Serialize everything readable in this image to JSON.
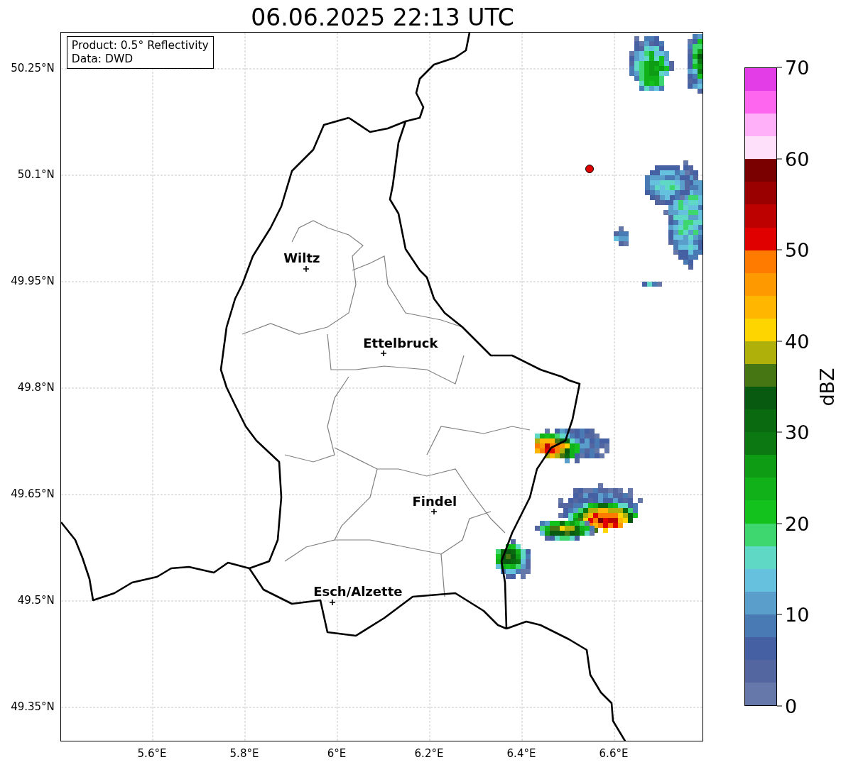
{
  "title": "06.06.2025 22:13 UTC",
  "legend": {
    "lines": [
      "Product: 0.5° Reflectivity",
      "Data: DWD"
    ]
  },
  "map": {
    "lat_ticks": [
      "50.25°N",
      "50.1°N",
      "49.95°N",
      "49.8°N",
      "49.65°N",
      "49.5°N",
      "49.35°N"
    ],
    "lon_ticks": [
      "5.6°E",
      "5.8°E",
      "6°E",
      "6.2°E",
      "6.4°E",
      "6.6°E"
    ],
    "cities": [
      {
        "name": "Wiltz"
      },
      {
        "name": "Ettelbruck"
      },
      {
        "name": "Findel"
      },
      {
        "name": "Esch/Alzette"
      }
    ]
  },
  "colorbar": {
    "label": "dBZ",
    "ticks": [
      "70",
      "60",
      "50",
      "40",
      "30",
      "20",
      "10",
      "0"
    ],
    "segments": [
      {
        "color": "#e33de8"
      },
      {
        "color": "#ff66f0"
      },
      {
        "color": "#ffb0f8"
      },
      {
        "color": "#ffe0fa"
      },
      {
        "color": "#7a0000"
      },
      {
        "color": "#9b0000"
      },
      {
        "color": "#bd0000"
      },
      {
        "color": "#e00000"
      },
      {
        "color": "#ff7b00"
      },
      {
        "color": "#ff9900"
      },
      {
        "color": "#ffb600"
      },
      {
        "color": "#ffd500"
      },
      {
        "color": "#b0b00a"
      },
      {
        "color": "#467514"
      },
      {
        "color": "#075a10"
      },
      {
        "color": "#0a6a10"
      },
      {
        "color": "#0b7812"
      },
      {
        "color": "#0f9c15"
      },
      {
        "color": "#11b219"
      },
      {
        "color": "#13c21c"
      },
      {
        "color": "#3ed66f"
      },
      {
        "color": "#60d8c6"
      },
      {
        "color": "#66c1de"
      },
      {
        "color": "#5a9fcb"
      },
      {
        "color": "#4a7ab3"
      },
      {
        "color": "#4560a3"
      },
      {
        "color": "#5366a0"
      },
      {
        "color": "#6677aa"
      }
    ]
  }
}
